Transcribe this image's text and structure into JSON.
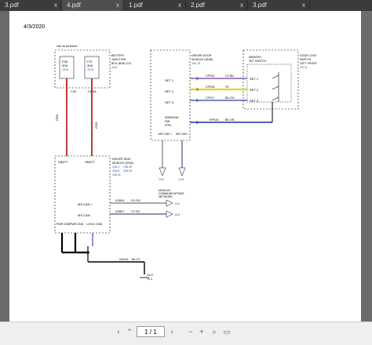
{
  "tabs": [
    {
      "label": "3.pdf",
      "close": "x"
    },
    {
      "label": "4.pdf",
      "close": "x"
    },
    {
      "label": "1.pdf",
      "close": "x"
    },
    {
      "label": "2.pdf",
      "close": "x"
    },
    {
      "label": "3.pdf",
      "close": "x"
    }
  ],
  "document": {
    "date": "4/3/2020",
    "hot_at_all_times": "Hot at all times",
    "fuses": [
      {
        "id": "F36",
        "rating": "30A",
        "ref": "13-8"
      },
      {
        "id": "F37",
        "rating": "30A",
        "ref": "13-5"
      }
    ],
    "bjb": [
      "BATTERY",
      "JUNCTION",
      "BOX (BJB) C1C",
      "13-6"
    ],
    "bjb_pins": [
      "C1B",
      "C100A"
    ],
    "driver_door_module": [
      "DRIVER DOOR",
      "MODULE (DDM)",
      "151-70"
    ],
    "driver_seat_module": [
      "DRIVER SEAT",
      "MODULE (DSM)",
      "126-1",
      "126-6",
      "126-11",
      "126-15",
      "126-20"
    ],
    "door_lock_switch": [
      "DOOR LOCK",
      "SWITCH,",
      "LEFT FRONT",
      "137-6"
    ],
    "memory_switch": [
      "MEMORY",
      "SET SWITCH"
    ],
    "set_labels": [
      "SET 1",
      "SET 2",
      "SET 3",
      "SET 1",
      "SET 2",
      "SET 3"
    ],
    "window_sw": [
      "WINDOW",
      "SW",
      "RTN"
    ],
    "ms_can_labels": [
      "MS CAN +",
      "MS CAN -"
    ],
    "dsm_labels": {
      "vbatt1": "VBATT",
      "vbatt2": "VBATT",
      "mscan_p": "MS CAN +",
      "mscan_m": "MS CAN -",
      "pwr_gnd1": "PWR GND",
      "pwr_gnd2": "PWR GND",
      "logic_gnd": "LOGIC GND"
    },
    "wires": [
      {
        "circuit": "CPS10",
        "color": "VT-BN"
      },
      {
        "circuit": "CPS15",
        "color": "YE"
      },
      {
        "circuit": "CPS17",
        "color": "BU-OG"
      },
      {
        "circuit": "RPS16",
        "color": "BK-GN"
      },
      {
        "circuit": "VDB04",
        "color": "GY-OG"
      },
      {
        "circuit": "VDB07",
        "color": "VT-OG"
      },
      {
        "circuit": "GD143",
        "color": "BK-VT"
      }
    ],
    "mcn": [
      "MODULE",
      "COMMUNICATIONS",
      "NETWORK"
    ],
    "ground": [
      "G117",
      "10-8"
    ],
    "c_labels": [
      "C500",
      "C525",
      "C501",
      "C541",
      "C3123",
      "C3125",
      "C3150",
      "C3151"
    ],
    "refs": [
      "14-9",
      "14-8",
      "14-9",
      "14-8"
    ]
  },
  "viewer": {
    "page_box": "1 / 1",
    "prev": "‹",
    "next": "›",
    "zoom_out": "−",
    "zoom_in": "+"
  }
}
